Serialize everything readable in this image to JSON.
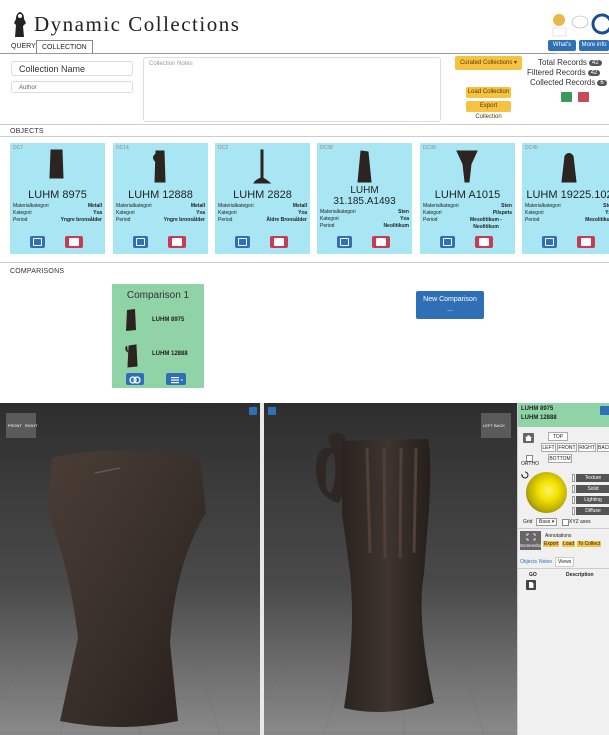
{
  "app": {
    "title": "Dynamic Collections",
    "logo_icon": "hand-axe-figure-icon"
  },
  "tabs": [
    {
      "label": "QUERY"
    },
    {
      "label": "COLLECTION"
    }
  ],
  "header_links": {
    "whats_new": "What's new",
    "more_info": "More info"
  },
  "collection": {
    "name_value": "Collection Name",
    "author_placeholder": "Author",
    "notes_placeholder": "Collection Notes",
    "curated_label": "Curated Collections ▾",
    "load_label": "Load Collection",
    "export_label": "Export Collection",
    "stats": {
      "total_label": "Total Records",
      "total_value": "42",
      "filtered_label": "Filtered Records",
      "filtered_value": "42",
      "collected_label": "Collected Records",
      "collected_value": "6"
    }
  },
  "objects_label": "OBJECTS",
  "objects": [
    {
      "id": "DC7",
      "title": "LUHM 8975",
      "rows": [
        [
          "Materialkategori",
          "Metall"
        ],
        [
          "Kategori",
          "Yxa"
        ],
        [
          "Period",
          "Yngre bronsålder"
        ]
      ]
    },
    {
      "id": "DC14",
      "title": "LUHM 12888",
      "rows": [
        [
          "Materialkategori",
          "Metall"
        ],
        [
          "Kategori",
          "Yxa"
        ],
        [
          "Period",
          "Yngre bronsålder"
        ]
      ]
    },
    {
      "id": "DC2",
      "title": "LUHM 2828",
      "rows": [
        [
          "Materialkategori",
          "Metall"
        ],
        [
          "Kategori",
          "Yxa"
        ],
        [
          "Period",
          "Äldre Bronsålder"
        ]
      ]
    },
    {
      "id": "DC38",
      "title": "LUHM 31.185.A1493",
      "rows": [
        [
          "Materialkategori",
          "Sten"
        ],
        [
          "Kategori",
          "Yxa"
        ],
        [
          "Period",
          "Neolitikum"
        ]
      ]
    },
    {
      "id": "DC39",
      "title": "LUHM A1015",
      "rows": [
        [
          "Materialkategori",
          "Sten"
        ],
        [
          "Kategori",
          "Pilspets"
        ],
        [
          "Period",
          "Mesolitikum - Neolitikum"
        ]
      ]
    },
    {
      "id": "DC45",
      "title": "LUHM 19225.102",
      "rows": [
        [
          "Materialkategori",
          "Sten"
        ],
        [
          "Kategori",
          "Yxa"
        ],
        [
          "Period",
          "Mesolitikum"
        ]
      ]
    }
  ],
  "comparisons_label": "COMPARISONS",
  "comparison": {
    "title": "Comparison 1",
    "items": [
      "LUHM 8975",
      "LUHM 12888"
    ]
  },
  "new_comparison_label": "New Comparison\n...",
  "viewers": {
    "left_cube": {
      "front": "FRONT",
      "right": "RIGHT"
    },
    "right_cube": {
      "left": "LEFT",
      "back": "BACK"
    }
  },
  "side_panel": {
    "items": [
      "LUHM 8975",
      "LUHM 12888"
    ],
    "views": [
      "TOP",
      "LEFT",
      "FRONT",
      "RIGHT",
      "BACK",
      "BOTTOM"
    ],
    "ortho": "ORTHO",
    "options": [
      "Texture",
      "Solid",
      "Lighting",
      "Diffuse"
    ],
    "grid_label": "Grid",
    "grid_value": "Base ▾",
    "xyz_label": "XYZ axes",
    "annotations_label": "Annotations",
    "screenshot_label": "Screenshot",
    "annot_actions": [
      "Export",
      "Load",
      "To Collect"
    ],
    "tabs": [
      "Objects",
      "Notes",
      "Views"
    ],
    "table_headers": [
      "GO",
      "Description"
    ]
  },
  "colors": {
    "card": "#a8e6f4",
    "comparison": "#8fd3a6",
    "primary": "#2f6fb5",
    "danger": "#c93b53",
    "warning": "#f5c242"
  }
}
